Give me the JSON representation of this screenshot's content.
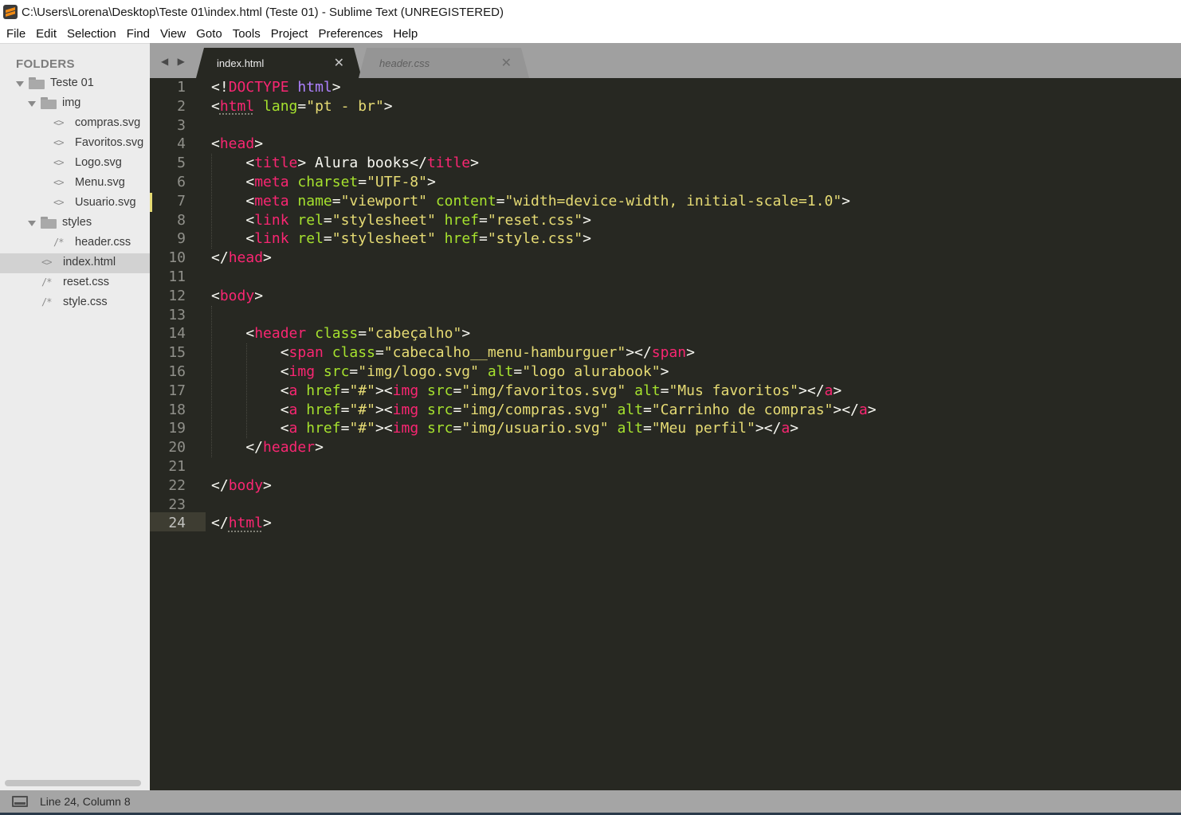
{
  "window": {
    "title": "C:\\Users\\Lorena\\Desktop\\Teste 01\\index.html (Teste 01) - Sublime Text (UNREGISTERED)",
    "app_icon": "sublime-text-icon"
  },
  "menu": [
    "File",
    "Edit",
    "Selection",
    "Find",
    "View",
    "Goto",
    "Tools",
    "Project",
    "Preferences",
    "Help"
  ],
  "sidebar": {
    "heading": "FOLDERS",
    "tree": [
      {
        "label": "Teste 01",
        "type": "folder",
        "expanded": true
      },
      {
        "label": "img",
        "type": "folder",
        "expanded": true
      },
      {
        "label": "compras.svg",
        "type": "file",
        "icon": "<>"
      },
      {
        "label": "Favoritos.svg",
        "type": "file",
        "icon": "<>"
      },
      {
        "label": "Logo.svg",
        "type": "file",
        "icon": "<>"
      },
      {
        "label": "Menu.svg",
        "type": "file",
        "icon": "<>"
      },
      {
        "label": "Usuario.svg",
        "type": "file",
        "icon": "<>"
      },
      {
        "label": "styles",
        "type": "folder",
        "expanded": true
      },
      {
        "label": "header.css",
        "type": "file",
        "icon": "/*"
      },
      {
        "label": "index.html",
        "type": "file",
        "icon": "<>",
        "selected": true
      },
      {
        "label": "reset.css",
        "type": "file",
        "icon": "/*"
      },
      {
        "label": "style.css",
        "type": "file",
        "icon": "/*"
      }
    ]
  },
  "tabs": {
    "nav_arrows": "◀ ▶",
    "items": [
      {
        "label": "index.html",
        "active": true,
        "close": "✕"
      },
      {
        "label": "header.css",
        "active": false,
        "close": "✕"
      }
    ]
  },
  "editor": {
    "current_line": 24,
    "modified_line": 7,
    "colors": {
      "background": "#272822",
      "tag": "#f92672",
      "attribute": "#a6e22e",
      "string": "#e6db74",
      "text": "#f8f8f2"
    },
    "lines": [
      [
        [
          "p",
          "<!"
        ],
        [
          "doct",
          "DOCTYPE"
        ],
        [
          "p",
          " "
        ],
        [
          "kw",
          "html"
        ],
        [
          "p",
          ">"
        ]
      ],
      [
        [
          "p",
          "<"
        ],
        [
          "tag",
          "html"
        ],
        [
          "p",
          " "
        ],
        [
          "attr",
          "lang"
        ],
        [
          "p",
          "="
        ],
        [
          "str",
          "\"pt - br\""
        ],
        [
          "p",
          ">"
        ]
      ],
      [],
      [
        [
          "p",
          "<"
        ],
        [
          "tag",
          "head"
        ],
        [
          "p",
          ">"
        ]
      ],
      [
        [
          "p",
          "    <"
        ],
        [
          "tag",
          "title"
        ],
        [
          "p",
          "> Alura books</"
        ],
        [
          "tag",
          "title"
        ],
        [
          "p",
          ">"
        ]
      ],
      [
        [
          "p",
          "    <"
        ],
        [
          "tag",
          "meta"
        ],
        [
          "p",
          " "
        ],
        [
          "attr",
          "charset"
        ],
        [
          "p",
          "="
        ],
        [
          "str",
          "\"UTF-8\""
        ],
        [
          "p",
          ">"
        ]
      ],
      [
        [
          "p",
          "    <"
        ],
        [
          "tag",
          "meta"
        ],
        [
          "p",
          " "
        ],
        [
          "attr",
          "name"
        ],
        [
          "p",
          "="
        ],
        [
          "str",
          "\"viewport\""
        ],
        [
          "p",
          " "
        ],
        [
          "attr",
          "content"
        ],
        [
          "p",
          "="
        ],
        [
          "str",
          "\"width=device-width, initial-scale=1.0\""
        ],
        [
          "p",
          ">"
        ]
      ],
      [
        [
          "p",
          "    <"
        ],
        [
          "tag",
          "link"
        ],
        [
          "p",
          " "
        ],
        [
          "attr",
          "rel"
        ],
        [
          "p",
          "="
        ],
        [
          "str",
          "\"stylesheet\""
        ],
        [
          "p",
          " "
        ],
        [
          "attr",
          "href"
        ],
        [
          "p",
          "="
        ],
        [
          "str",
          "\"reset.css\""
        ],
        [
          "p",
          ">"
        ]
      ],
      [
        [
          "p",
          "    <"
        ],
        [
          "tag",
          "link"
        ],
        [
          "p",
          " "
        ],
        [
          "attr",
          "rel"
        ],
        [
          "p",
          "="
        ],
        [
          "str",
          "\"stylesheet\""
        ],
        [
          "p",
          " "
        ],
        [
          "attr",
          "href"
        ],
        [
          "p",
          "="
        ],
        [
          "str",
          "\"style.css\""
        ],
        [
          "p",
          ">"
        ]
      ],
      [
        [
          "p",
          "</"
        ],
        [
          "tag",
          "head"
        ],
        [
          "p",
          ">"
        ]
      ],
      [],
      [
        [
          "p",
          "<"
        ],
        [
          "tag",
          "body"
        ],
        [
          "p",
          ">"
        ]
      ],
      [],
      [
        [
          "p",
          "    <"
        ],
        [
          "tag",
          "header"
        ],
        [
          "p",
          " "
        ],
        [
          "attr",
          "class"
        ],
        [
          "p",
          "="
        ],
        [
          "str",
          "\"cabeçalho\""
        ],
        [
          "p",
          ">"
        ]
      ],
      [
        [
          "p",
          "        <"
        ],
        [
          "tag",
          "span"
        ],
        [
          "p",
          " "
        ],
        [
          "attr",
          "class"
        ],
        [
          "p",
          "="
        ],
        [
          "str",
          "\"cabecalho__menu-hamburguer\""
        ],
        [
          "p",
          "></"
        ],
        [
          "tag",
          "span"
        ],
        [
          "p",
          ">"
        ]
      ],
      [
        [
          "p",
          "        <"
        ],
        [
          "tag",
          "img"
        ],
        [
          "p",
          " "
        ],
        [
          "attr",
          "src"
        ],
        [
          "p",
          "="
        ],
        [
          "str",
          "\"img/logo.svg\""
        ],
        [
          "p",
          " "
        ],
        [
          "attr",
          "alt"
        ],
        [
          "p",
          "="
        ],
        [
          "str",
          "\"logo alurabook\""
        ],
        [
          "p",
          ">"
        ]
      ],
      [
        [
          "p",
          "        <"
        ],
        [
          "tag",
          "a"
        ],
        [
          "p",
          " "
        ],
        [
          "attr",
          "href"
        ],
        [
          "p",
          "="
        ],
        [
          "str",
          "\"#\""
        ],
        [
          "p",
          "><"
        ],
        [
          "tag",
          "img"
        ],
        [
          "p",
          " "
        ],
        [
          "attr",
          "src"
        ],
        [
          "p",
          "="
        ],
        [
          "str",
          "\"img/favoritos.svg\""
        ],
        [
          "p",
          " "
        ],
        [
          "attr",
          "alt"
        ],
        [
          "p",
          "="
        ],
        [
          "str",
          "\"Mus favoritos\""
        ],
        [
          "p",
          "></"
        ],
        [
          "tag",
          "a"
        ],
        [
          "p",
          ">"
        ]
      ],
      [
        [
          "p",
          "        <"
        ],
        [
          "tag",
          "a"
        ],
        [
          "p",
          " "
        ],
        [
          "attr",
          "href"
        ],
        [
          "p",
          "="
        ],
        [
          "str",
          "\"#\""
        ],
        [
          "p",
          "><"
        ],
        [
          "tag",
          "img"
        ],
        [
          "p",
          " "
        ],
        [
          "attr",
          "src"
        ],
        [
          "p",
          "="
        ],
        [
          "str",
          "\"img/compras.svg\""
        ],
        [
          "p",
          " "
        ],
        [
          "attr",
          "alt"
        ],
        [
          "p",
          "="
        ],
        [
          "str",
          "\"Carrinho de compras\""
        ],
        [
          "p",
          "></"
        ],
        [
          "tag",
          "a"
        ],
        [
          "p",
          ">"
        ]
      ],
      [
        [
          "p",
          "        <"
        ],
        [
          "tag",
          "a"
        ],
        [
          "p",
          " "
        ],
        [
          "attr",
          "href"
        ],
        [
          "p",
          "="
        ],
        [
          "str",
          "\"#\""
        ],
        [
          "p",
          "><"
        ],
        [
          "tag",
          "img"
        ],
        [
          "p",
          " "
        ],
        [
          "attr",
          "src"
        ],
        [
          "p",
          "="
        ],
        [
          "str",
          "\"img/usuario.svg\""
        ],
        [
          "p",
          " "
        ],
        [
          "attr",
          "alt"
        ],
        [
          "p",
          "="
        ],
        [
          "str",
          "\"Meu perfil\""
        ],
        [
          "p",
          "></"
        ],
        [
          "tag",
          "a"
        ],
        [
          "p",
          ">"
        ]
      ],
      [
        [
          "p",
          "    </"
        ],
        [
          "tag",
          "header"
        ],
        [
          "p",
          ">"
        ]
      ],
      [],
      [
        [
          "p",
          "</"
        ],
        [
          "tag",
          "body"
        ],
        [
          "p",
          ">"
        ]
      ],
      [],
      [
        [
          "p",
          "</"
        ],
        [
          "tag",
          "html"
        ],
        [
          "p",
          ">"
        ]
      ]
    ]
  },
  "status_bar": {
    "icon": "panel-toggle-icon",
    "text": "Line 24, Column 8"
  }
}
